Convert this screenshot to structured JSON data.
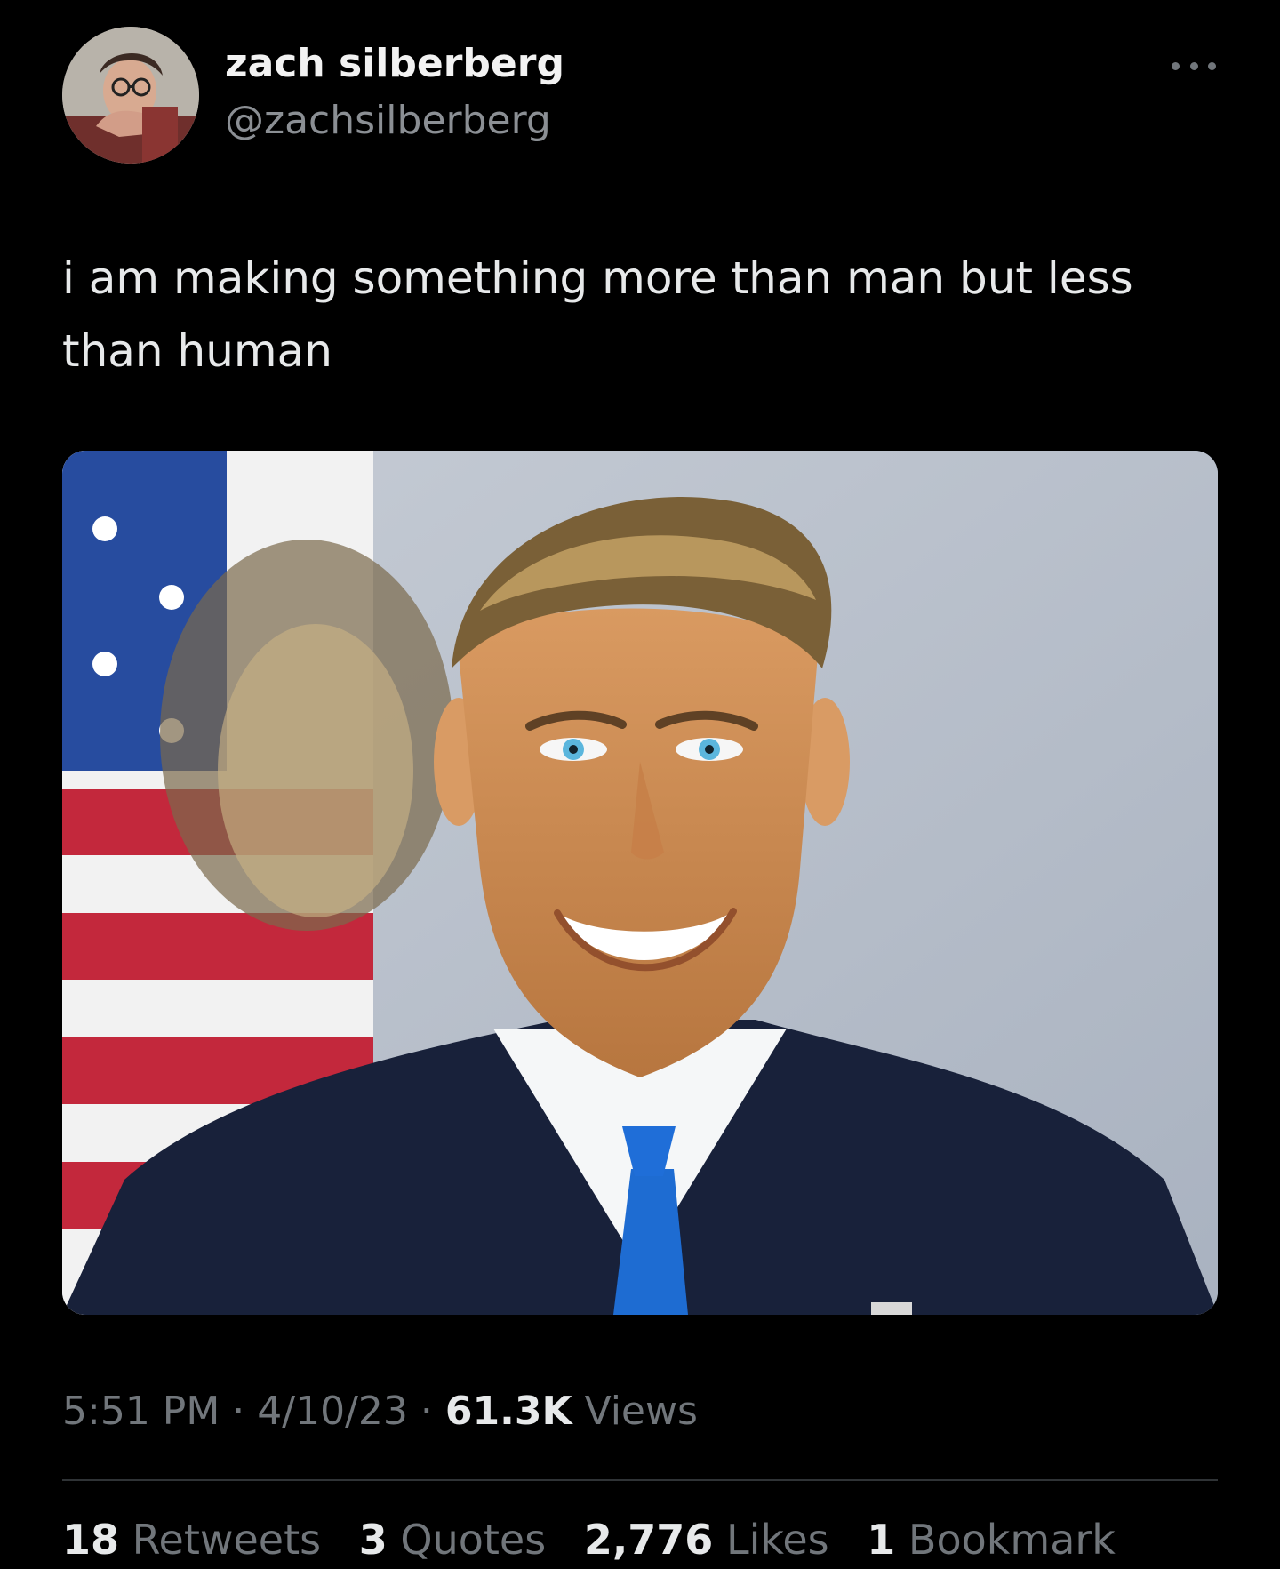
{
  "user": {
    "display_name": "zach silberberg",
    "handle": "@zachsilberberg",
    "avatar_icon": "profile-photo"
  },
  "menu": {
    "more_icon": "more-options-icon"
  },
  "tweet": {
    "text": "i am making something more than man but less than human"
  },
  "media": {
    "icon": "photo"
  },
  "meta": {
    "time": "5:51 PM",
    "separator": "·",
    "date": "4/10/23",
    "views_count": "61.3K",
    "views_label": "Views"
  },
  "stats": {
    "retweets_count": "18",
    "retweets_label": "Retweets",
    "quotes_count": "3",
    "quotes_label": "Quotes",
    "likes_count": "2,776",
    "likes_label": "Likes",
    "bookmarks_count": "1",
    "bookmarks_label": "Bookmark"
  },
  "colors": {
    "background": "#000000",
    "text": "#e7e9ea",
    "muted": "#71767b",
    "divider": "#2f3336"
  }
}
